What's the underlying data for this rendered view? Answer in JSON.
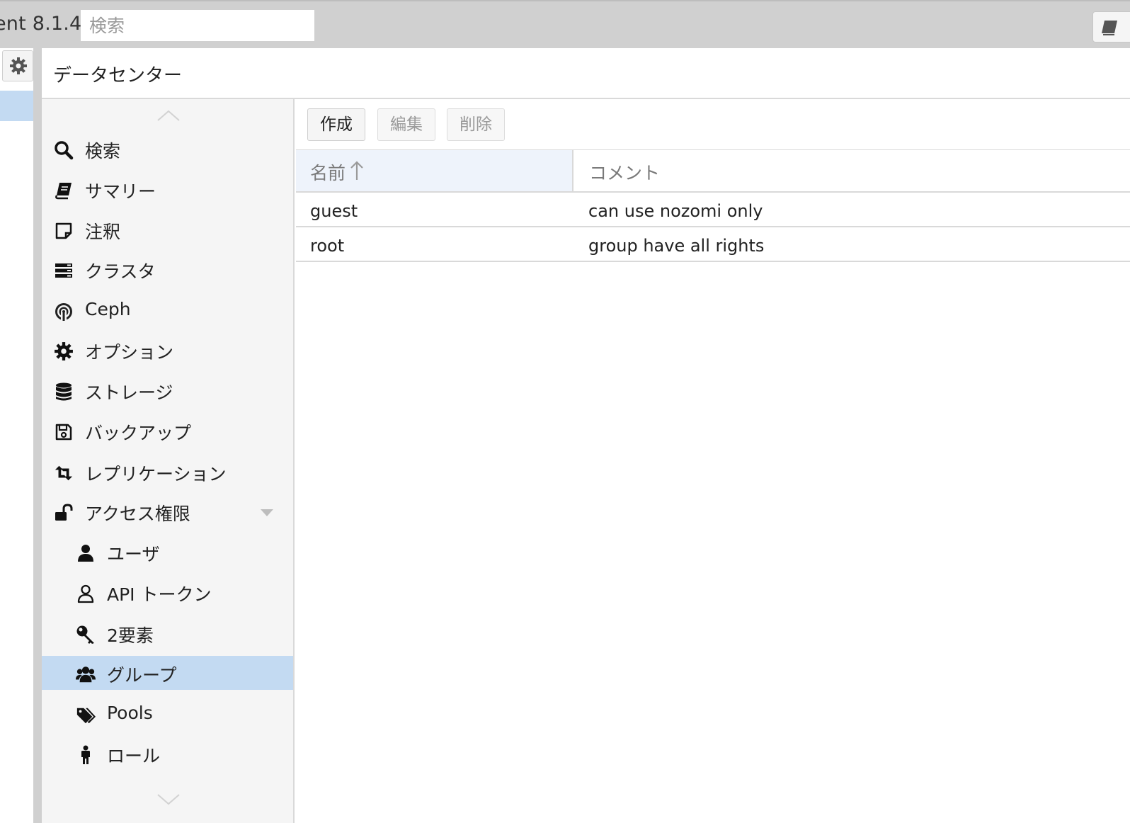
{
  "topbar": {
    "version_text": "ent 8.1.4",
    "search_placeholder": "検索"
  },
  "panel": {
    "title": "データセンター"
  },
  "nav": {
    "items": [
      {
        "label": "検索",
        "icon": "search-icon"
      },
      {
        "label": "サマリー",
        "icon": "book-icon"
      },
      {
        "label": "注釈",
        "icon": "note-icon"
      },
      {
        "label": "クラスタ",
        "icon": "server-icon"
      },
      {
        "label": "Ceph",
        "icon": "ceph-icon"
      },
      {
        "label": "オプション",
        "icon": "gear-icon"
      },
      {
        "label": "ストレージ",
        "icon": "database-icon"
      },
      {
        "label": "バックアップ",
        "icon": "floppy-icon"
      },
      {
        "label": "レプリケーション",
        "icon": "retweet-icon"
      },
      {
        "label": "アクセス権限",
        "icon": "unlock-icon",
        "expanded": true
      },
      {
        "label": "ユーザ",
        "icon": "user-icon"
      },
      {
        "label": "API トークン",
        "icon": "user-outline-icon"
      },
      {
        "label": "2要素",
        "icon": "key-icon"
      },
      {
        "label": "グループ",
        "icon": "users-icon",
        "selected": true
      },
      {
        "label": "Pools",
        "icon": "tags-icon"
      },
      {
        "label": "ロール",
        "icon": "male-icon"
      }
    ]
  },
  "toolbar": {
    "create_label": "作成",
    "edit_label": "編集",
    "delete_label": "削除"
  },
  "grid": {
    "columns": [
      "名前",
      "コメント"
    ],
    "sort": "ascending",
    "rows": [
      {
        "name": "guest",
        "comment": "can use nozomi only"
      },
      {
        "name": "root",
        "comment": "group have all rights"
      }
    ]
  },
  "colors": {
    "selected_bg": "#c3daf2",
    "header_sort_bg": "#eef3fb",
    "topbar_bg": "#d0d0d0"
  }
}
